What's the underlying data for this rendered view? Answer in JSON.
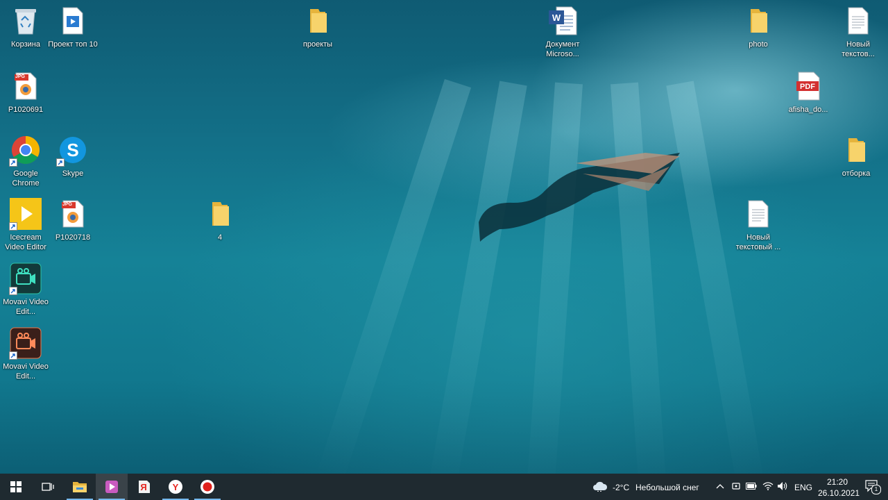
{
  "desktop": {
    "icons": [
      {
        "label": "Корзина",
        "icon": "recycle-bin-icon"
      },
      {
        "label": "Проект топ 10",
        "icon": "video-file-icon"
      },
      {
        "label": "P1020691",
        "icon": "jpg-file-icon"
      },
      {
        "label": "Google Chrome",
        "icon": "chrome-icon"
      },
      {
        "label": "Skype",
        "icon": "skype-icon"
      },
      {
        "label": "Icecream Video Editor",
        "icon": "icecream-video-editor-icon"
      },
      {
        "label": "P1020718",
        "icon": "jpg-file-icon"
      },
      {
        "label": "Movavi Video Edit...",
        "icon": "movavi-video-editor-icon"
      },
      {
        "label": "Movavi Video Edit...",
        "icon": "movavi-video-editor-icon"
      },
      {
        "label": "проекты",
        "icon": "folder-icon"
      },
      {
        "label": "4",
        "icon": "folder-icon"
      },
      {
        "label": "Документ Microso...",
        "icon": "word-document-icon"
      },
      {
        "label": "photo",
        "icon": "folder-icon"
      },
      {
        "label": "Новый текстовый ...",
        "icon": "text-document-icon"
      },
      {
        "label": "Новый текстов...",
        "icon": "text-document-icon"
      },
      {
        "label": "afisha_do...",
        "icon": "pdf-file-icon"
      },
      {
        "label": "отборка",
        "icon": "folder-icon"
      }
    ],
    "jpg_badge": "JPG",
    "pdf_badge": "PDF"
  },
  "taskbar": {
    "buttons": [
      "start-icon",
      "task-view-icon",
      "file-explorer-icon",
      "movavi-video-editor-icon",
      "yandex-icon",
      "yandex-browser-icon",
      "screen-recorder-icon"
    ],
    "weather": {
      "temp": "-2°C",
      "condition": "Небольшой снег"
    },
    "language": "ENG",
    "time": "21:20",
    "date": "26.10.2021",
    "notifications_count": "1"
  },
  "colors": {
    "taskbar_bg": "#1f2a30",
    "accent_underline": "#76b9ed",
    "folder_yellow": "#f3c94e"
  }
}
